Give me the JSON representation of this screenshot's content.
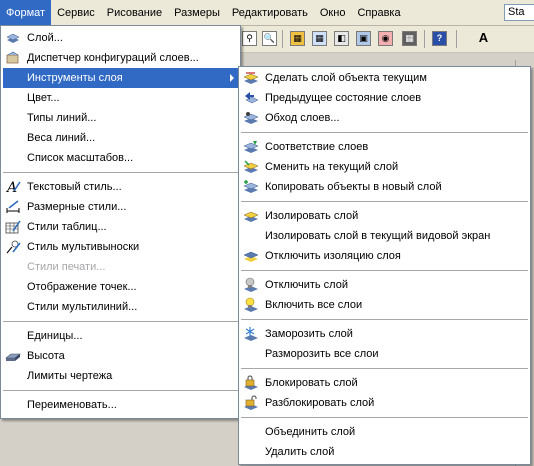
{
  "menubar": {
    "items": [
      "Формат",
      "Сервис",
      "Рисование",
      "Размеры",
      "Редактировать",
      "Окно",
      "Справка"
    ],
    "active_index": 0
  },
  "toolbar": {
    "style_combo_value": "Sta"
  },
  "format_menu": {
    "items": [
      {
        "label": "Слой...",
        "icon": "layers-icon"
      },
      {
        "label": "Диспетчер конфигураций слоев...",
        "icon": "layer-states-icon"
      },
      {
        "label": "Инструменты слоя",
        "icon": "",
        "submenu": true,
        "selected": true
      },
      {
        "label": "Цвет...",
        "icon": ""
      },
      {
        "label": "Типы линий...",
        "icon": ""
      },
      {
        "label": "Веса линий...",
        "icon": ""
      },
      {
        "label": "Список масштабов...",
        "icon": ""
      },
      {
        "label": "Текстовый стиль...",
        "icon": "text-style-icon"
      },
      {
        "label": "Размерные стили...",
        "icon": "dimension-style-icon"
      },
      {
        "label": "Стили таблиц...",
        "icon": "table-style-icon"
      },
      {
        "label": "Стиль мультивыноски",
        "icon": "multileader-style-icon"
      },
      {
        "label": "Стили печати...",
        "icon": "",
        "disabled": true
      },
      {
        "label": "Отображение точек...",
        "icon": ""
      },
      {
        "label": "Стили мультилиний...",
        "icon": ""
      },
      {
        "label": "Единицы...",
        "icon": ""
      },
      {
        "label": "Высота",
        "icon": "thickness-icon"
      },
      {
        "label": "Лимиты чертежа",
        "icon": ""
      },
      {
        "label": "Переименовать...",
        "icon": ""
      }
    ]
  },
  "layer_tools_menu": {
    "items": [
      {
        "label": "Сделать слой объекта текущим",
        "icon": "make-current-icon"
      },
      {
        "label": "Предыдущее состояние слоев",
        "icon": "layer-previous-icon"
      },
      {
        "label": "Обход слоев...",
        "icon": "layer-walk-icon"
      },
      {
        "label": "Соответствие слоев",
        "icon": "layer-match-icon"
      },
      {
        "label": "Сменить на текущий слой",
        "icon": "change-to-current-icon"
      },
      {
        "label": "Копировать объекты в новый слой",
        "icon": "copy-to-layer-icon"
      },
      {
        "label": "Изолировать слой",
        "icon": "layer-isolate-icon"
      },
      {
        "label": "Изолировать слой в текущий видовой экран",
        "icon": ""
      },
      {
        "label": "Отключить изоляцию слоя",
        "icon": "layer-unisolate-icon"
      },
      {
        "label": "Отключить слой",
        "icon": "layer-off-icon"
      },
      {
        "label": "Включить все слои",
        "icon": "layer-on-icon"
      },
      {
        "label": "Заморозить слой",
        "icon": "layer-freeze-icon"
      },
      {
        "label": "Разморозить все слои",
        "icon": ""
      },
      {
        "label": "Блокировать слой",
        "icon": "layer-lock-icon"
      },
      {
        "label": "Разблокировать слой",
        "icon": "layer-unlock-icon"
      },
      {
        "label": "Объединить слой",
        "icon": ""
      },
      {
        "label": "Удалить слой",
        "icon": ""
      }
    ]
  },
  "colors": {
    "selection": "#316ac5",
    "menu_background": "#ffffff",
    "menubar_background": "#ece9d8",
    "disabled_text": "#a7a6aa"
  }
}
